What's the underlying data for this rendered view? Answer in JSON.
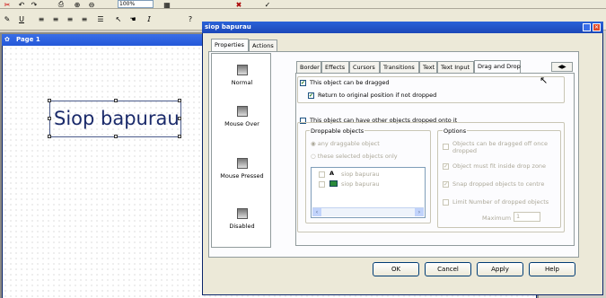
{
  "toolbar": {
    "zoom_value": "100%",
    "row1_icons": [
      "cut-icon",
      "undo-icon",
      "redo-icon",
      "print-icon",
      "zoom-in-icon",
      "zoom-out-icon"
    ],
    "row2_icons": [
      "pen-icon",
      "underline-icon",
      "align-left-icon",
      "align-center-icon",
      "align-right-icon",
      "align-justify-icon",
      "list-icon",
      "pointer-icon"
    ]
  },
  "page_window": {
    "title": "Page 1",
    "text_object": "Siop bapurau"
  },
  "dialog": {
    "title": "siop bapurau",
    "top_tabs": [
      "Properties",
      "Actions"
    ],
    "states": [
      "Normal",
      "Mouse Over",
      "Mouse Pressed",
      "Disabled"
    ],
    "tabs": [
      "Border",
      "Effects",
      "Cursors",
      "Transitions",
      "Text",
      "Text Input",
      "Drag and Drop"
    ],
    "drag": {
      "can_be_dragged": "This object can be dragged",
      "return_to_original": "Return to original position if not dropped"
    },
    "drop": {
      "can_have_dropped": "This object can have other objects dropped onto it",
      "droppable_objects_label": "Droppable objects",
      "any_draggable": "any draggable object",
      "these_selected": "these selected objects only",
      "list_items": [
        "siop bapurau",
        "siop bapurau"
      ],
      "options_label": "Options",
      "opt1": "Objects can be dragged off once dropped",
      "opt2": "Object must fit inside drop zone",
      "opt3": "Snap dropped objects to centre",
      "opt4": "Limit Number of dropped objects",
      "maximum_label": "Maximum",
      "maximum_value": "1"
    },
    "buttons": {
      "ok": "OK",
      "cancel": "Cancel",
      "apply": "Apply",
      "help": "Help"
    }
  }
}
